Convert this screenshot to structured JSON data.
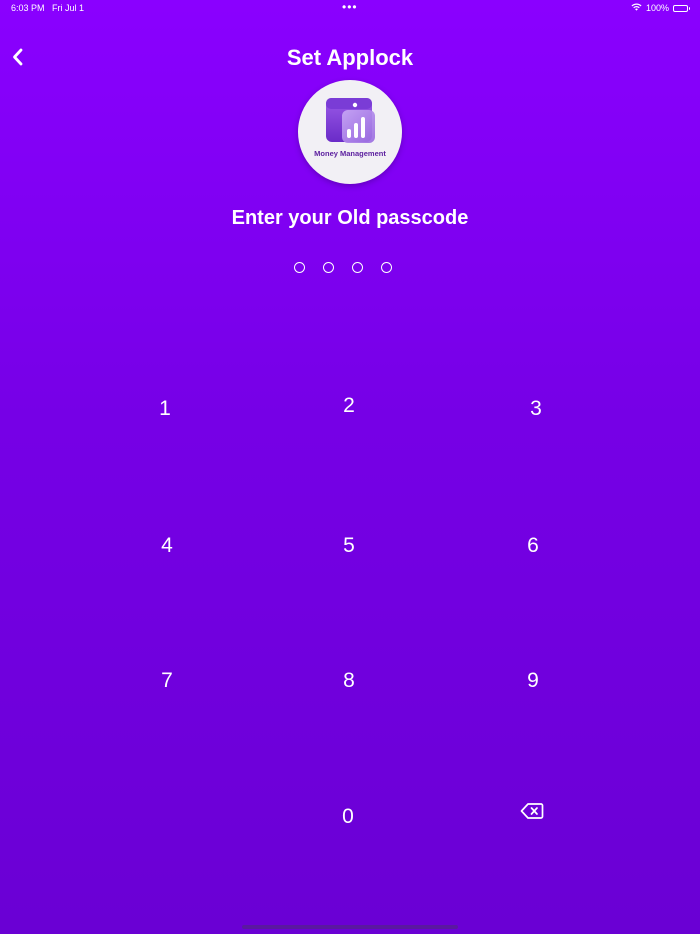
{
  "status_bar": {
    "time": "6:03 PM",
    "date": "Fri Jul 1",
    "dots": "•••",
    "battery_percent": "100%",
    "wifi_icon": "wifi-icon",
    "battery_icon": "battery-icon"
  },
  "header": {
    "title": "Set Applock",
    "back_icon": "chevron-left-icon"
  },
  "logo": {
    "text": "Money Management",
    "icon": "wallet-chart-icon"
  },
  "prompt": "Enter your Old passcode",
  "passcode": {
    "length": 4,
    "filled": 0
  },
  "keypad": {
    "keys": [
      "1",
      "2",
      "3",
      "4",
      "5",
      "6",
      "7",
      "8",
      "9",
      "0"
    ],
    "delete_icon": "backspace-icon"
  },
  "colors": {
    "background_top": "#8a00ff",
    "background_bottom": "#6a00d4",
    "text": "#ffffff",
    "logo_text": "#5b1e9e"
  }
}
